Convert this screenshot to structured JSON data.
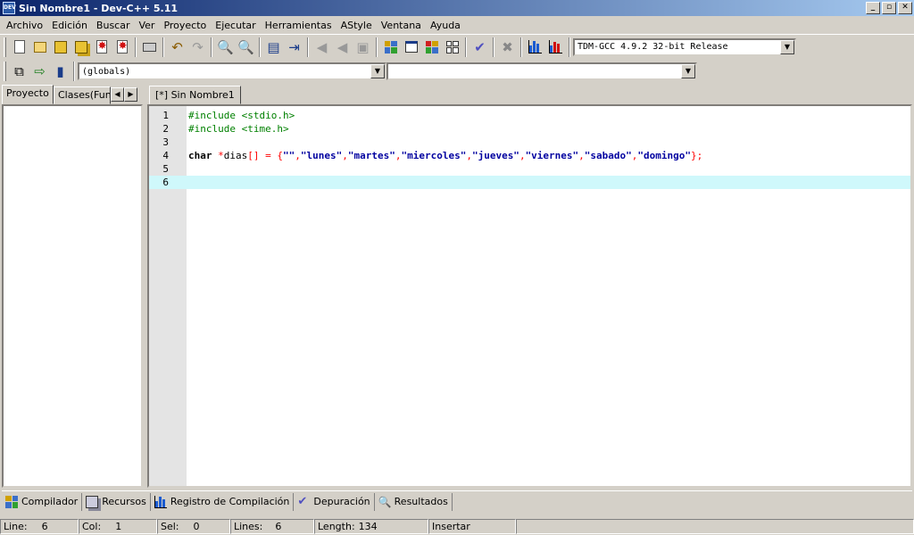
{
  "window": {
    "title": "Sin Nombre1 - Dev-C++ 5.11",
    "app_icon": "devcpp-icon",
    "buttons": {
      "minimize": "_",
      "restore": "▫",
      "close": "✕"
    }
  },
  "menu": [
    "Archivo",
    "Edición",
    "Buscar",
    "Ver",
    "Proyecto",
    "Ejecutar",
    "Herramientas",
    "AStyle",
    "Ventana",
    "Ayuda"
  ],
  "toolbar": {
    "compiler_select": "TDM-GCC 4.9.2 32-bit Release",
    "scope_select": "(globals)",
    "member_select": ""
  },
  "left_panel": {
    "tabs": [
      "Proyecto",
      "Clases(Fun"
    ],
    "active_tab": "Proyecto"
  },
  "editor": {
    "tab_label": "[*] Sin Nombre1",
    "current_line": 6,
    "lines": [
      {
        "num": "1",
        "tokens": [
          {
            "t": "#include <stdio.h>",
            "c": "c-pre"
          }
        ]
      },
      {
        "num": "2",
        "tokens": [
          {
            "t": "#include <time.h>",
            "c": "c-pre"
          }
        ]
      },
      {
        "num": "3",
        "tokens": []
      },
      {
        "num": "4",
        "tokens": [
          {
            "t": "char",
            "c": "c-kw"
          },
          {
            "t": " ",
            "c": "c-id"
          },
          {
            "t": "*",
            "c": "c-sym"
          },
          {
            "t": "dias",
            "c": "c-id"
          },
          {
            "t": "[]",
            "c": "c-sym"
          },
          {
            "t": " = {",
            "c": "c-sym"
          },
          {
            "t": "\"\"",
            "c": "c-str"
          },
          {
            "t": ",",
            "c": "c-sym"
          },
          {
            "t": "\"lunes\"",
            "c": "c-str"
          },
          {
            "t": ",",
            "c": "c-sym"
          },
          {
            "t": "\"martes\"",
            "c": "c-str"
          },
          {
            "t": ",",
            "c": "c-sym"
          },
          {
            "t": "\"miercoles\"",
            "c": "c-str"
          },
          {
            "t": ",",
            "c": "c-sym"
          },
          {
            "t": "\"jueves\"",
            "c": "c-str"
          },
          {
            "t": ",",
            "c": "c-sym"
          },
          {
            "t": "\"viernes\"",
            "c": "c-str"
          },
          {
            "t": ",",
            "c": "c-sym"
          },
          {
            "t": "\"sabado\"",
            "c": "c-str"
          },
          {
            "t": ",",
            "c": "c-sym"
          },
          {
            "t": "\"domingo\"",
            "c": "c-str"
          },
          {
            "t": "};",
            "c": "c-sym"
          }
        ]
      },
      {
        "num": "5",
        "tokens": []
      },
      {
        "num": "6",
        "tokens": []
      }
    ]
  },
  "bottom_tabs": [
    {
      "label": "Compilador",
      "icon": "compiler-icon"
    },
    {
      "label": "Recursos",
      "icon": "resources-icon"
    },
    {
      "label": "Registro de Compilación",
      "icon": "compile-log-icon"
    },
    {
      "label": "Depuración",
      "icon": "debug-icon"
    },
    {
      "label": "Resultados",
      "icon": "results-icon"
    }
  ],
  "status": {
    "line_label": "Line:",
    "line_value": "6",
    "col_label": "Col:",
    "col_value": "1",
    "sel_label": "Sel:",
    "sel_value": "0",
    "lines_label": "Lines:",
    "lines_value": "6",
    "length_label": "Length:",
    "length_value": "134",
    "mode": "Insertar"
  },
  "colors": {
    "title_gradient_start": "#0a246a",
    "current_line": "#cff8fb",
    "preprocessor": "#008000",
    "string": "#0000a0",
    "symbol": "#ff0000"
  }
}
